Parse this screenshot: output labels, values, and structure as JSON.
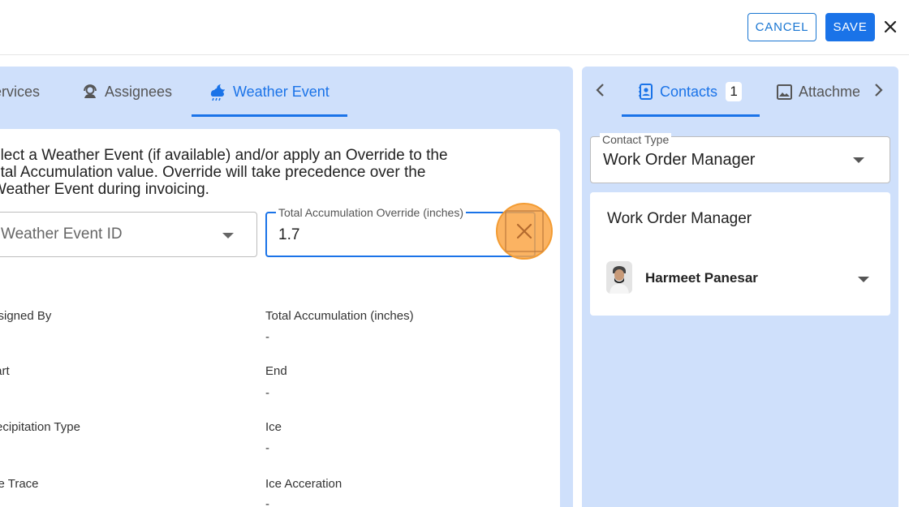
{
  "header": {
    "cancel_label": "CANCEL",
    "save_label": "SAVE"
  },
  "left_tabs": [
    {
      "label": "ervices",
      "icon": "services-icon"
    },
    {
      "label": "Assignees",
      "icon": "support-agent-icon"
    },
    {
      "label": "Weather Event",
      "icon": "weather-storm-icon",
      "active": true
    }
  ],
  "weather": {
    "description": "elect a Weather Event (if available) and/or apply an Override to the otal Accumulation value. Override will take precedence over the Weather Event during invoicing.",
    "description_lines": [
      "elect a Weather Event (if available) and/or apply an Override to the",
      "otal Accumulation value. Override will take precedence over the",
      "Weather Event during invoicing."
    ],
    "event_select_placeholder": "Weather Event ID",
    "override_label": "Total Accumulation Override (inches)",
    "override_value": "1.7"
  },
  "fields": [
    {
      "label": "ssigned By",
      "value": ""
    },
    {
      "label": "Total Accumulation (inches)",
      "value": "-"
    },
    {
      "label": "tart",
      "value": ""
    },
    {
      "label": "End",
      "value": "-"
    },
    {
      "label": "recipitation Type",
      "value": ""
    },
    {
      "label": "Ice",
      "value": "-"
    },
    {
      "label": "ce Trace",
      "value": ""
    },
    {
      "label": "Ice Acceration",
      "value": "-"
    }
  ],
  "right_tabs": {
    "contacts_label": "Contacts",
    "contacts_count": "1",
    "attachments_label": "Attachme"
  },
  "contacts": {
    "type_label": "Contact Type",
    "type_value": "Work Order Manager",
    "card_title": "Work Order Manager",
    "person_name": "Harmeet Panesar"
  },
  "colors": {
    "accent": "#1a73e8",
    "panel_bg": "#cfe0fb",
    "highlight": "#faa646"
  }
}
